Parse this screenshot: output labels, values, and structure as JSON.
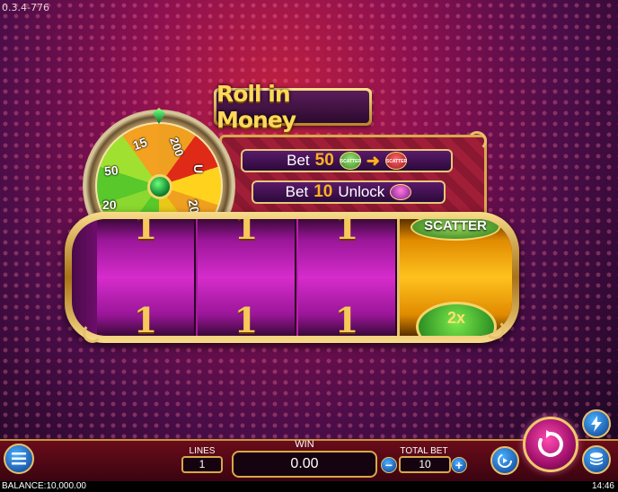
{
  "app": {
    "version": "0.3.4-776",
    "logo_text": "Roll in Money"
  },
  "wheel": {
    "labels": [
      "15",
      "200",
      "U",
      "50",
      "20",
      "20"
    ]
  },
  "info": {
    "row1_prefix": "Bet",
    "row1_value": "50",
    "row2_prefix": "Bet",
    "row2_value": "10",
    "row2_suffix": "Unlock"
  },
  "reels": {
    "symbol": "1",
    "bonus_label": "SCATTER",
    "bonus_value": "2x"
  },
  "controls": {
    "lines_label": "LINES",
    "lines_value": "1",
    "win_label": "WIN",
    "win_value": "0.00",
    "total_bet_label": "TOTAL BET",
    "total_bet_value": "10",
    "minus": "−",
    "plus": "+"
  },
  "status": {
    "balance": "BALANCE:10,000.00",
    "time": "14:46"
  }
}
